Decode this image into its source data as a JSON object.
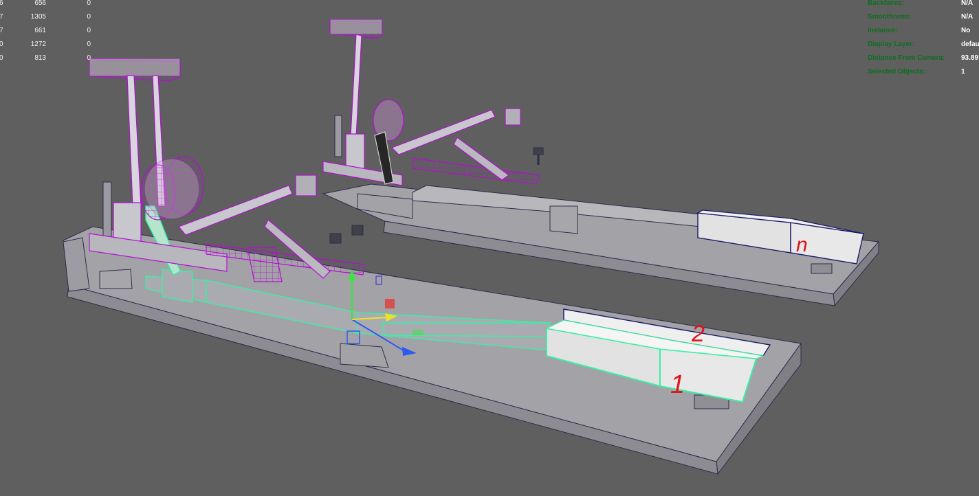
{
  "hud_stats": {
    "rows": [
      {
        "idx": "6",
        "a": "656",
        "b": "0"
      },
      {
        "idx": "7",
        "a": "1305",
        "b": "0"
      },
      {
        "idx": "7",
        "a": "661",
        "b": "0"
      },
      {
        "idx": "0",
        "a": "1272",
        "b": "0"
      },
      {
        "idx": "0",
        "a": "813",
        "b": "0"
      }
    ]
  },
  "object_info": {
    "rows": [
      {
        "label": "Backfaces:",
        "value": "N/A"
      },
      {
        "label": "Smoothness:",
        "value": "N/A"
      },
      {
        "label": "Instance:",
        "value": "No"
      },
      {
        "label": "Display Layer:",
        "value": "defau"
      },
      {
        "label": "Distance From Camera:",
        "value": "93.89"
      },
      {
        "label": "Selected Objects:",
        "value": "1"
      }
    ]
  },
  "annotations": {
    "mark_1": "1",
    "mark_2": "2",
    "mark_n": "n"
  },
  "colors": {
    "background": "#5f5f5f",
    "mesh_fill": "#a3a3a7",
    "mesh_wire": "#2b2b4a",
    "selected_wire": "#b40fd2",
    "highlight_wire": "#39f0a4",
    "hud_label": "#0c6e1e",
    "annotation": "#e0141e"
  }
}
